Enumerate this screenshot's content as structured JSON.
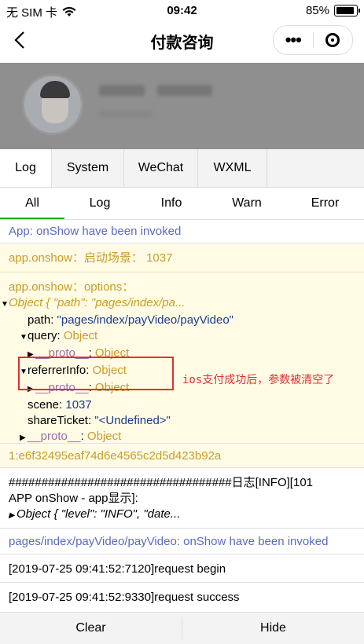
{
  "status": {
    "carrier": "无 SIM 卡",
    "time": "09:42",
    "battery": "85%",
    "battery_level": 0.85
  },
  "nav": {
    "title": "付款咨询"
  },
  "tabs_top": [
    "Log",
    "System",
    "WeChat",
    "WXML"
  ],
  "tabs_filter": [
    "All",
    "Log",
    "Info",
    "Warn",
    "Error"
  ],
  "log": {
    "l1": "App: onShow have been invoked",
    "l2": "app.onshow：启动场景： 1037",
    "l3_head": "app.onshow：options：",
    "obj_line": "Object { \"path\": \"pages/index/pa...",
    "path_key": "path",
    "path_val": "\"pages/index/payVideo/payVideo\"",
    "query_key": "query",
    "query_val": "Object",
    "proto_key": "__proto__",
    "proto_val": "Object",
    "referrer_key": "referrerInfo",
    "referrer_val": "Object",
    "scene_key": "scene",
    "scene_val": "1037",
    "share_key": "shareTicket",
    "share_val": "\"<Undefined>\"",
    "hash": "1:e6f32495eaf74d6e4565c2d5d423b92a",
    "log_a1": "##################################日志[INFO][101",
    "log_a2": "APP onShow - app显示]:",
    "log_a3": "Object { \"level\": \"INFO\", \"date...",
    "l_pages": "pages/index/payVideo/payVideo: onShow have been invoked",
    "req1": "[2019-07-25 09:41:52:7120]request begin",
    "req2": "[2019-07-25 09:41:52:9330]request success"
  },
  "annotation": "ios支付成功后，参数被清空了",
  "bottom": {
    "clear": "Clear",
    "hide": "Hide"
  }
}
